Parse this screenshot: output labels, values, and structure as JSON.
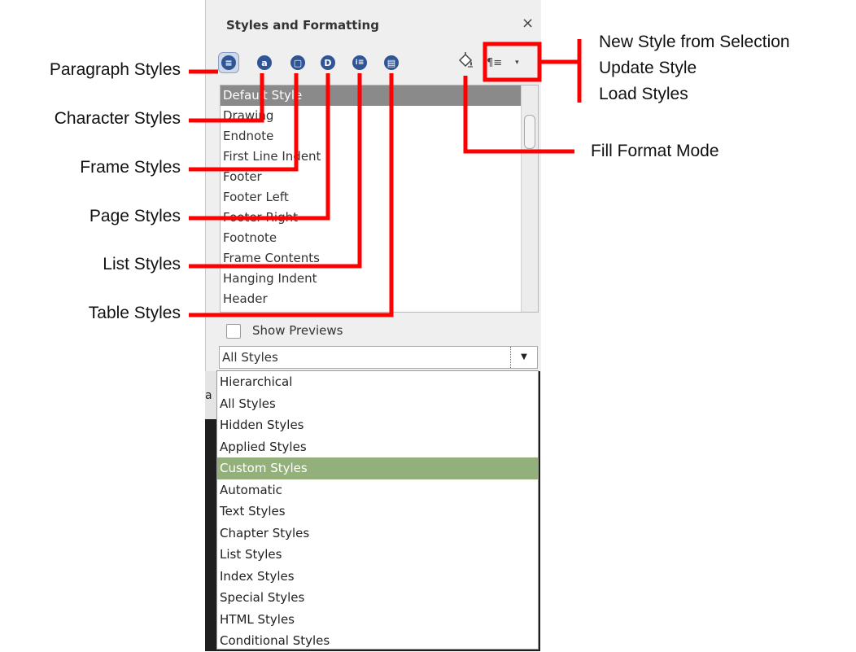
{
  "panel": {
    "title": "Styles and Formatting",
    "close_label": "×",
    "style_categories": [
      "Paragraph Styles",
      "Character Styles",
      "Frame Styles",
      "Page Styles",
      "List Styles",
      "Table Styles"
    ],
    "icon_glyphs": [
      "≡",
      "a",
      "▢",
      "D",
      "⁝≡",
      "▤"
    ],
    "new_style_glyph": "¶≡",
    "new_style_arrow": "▾",
    "styles": [
      "Default Style",
      "Drawing",
      "Endnote",
      "First Line Indent",
      "Footer",
      "Footer Left",
      "Footer Right",
      "Footnote",
      "Frame Contents",
      "Hanging Indent",
      "Header"
    ],
    "selected_style": "Default Style",
    "show_previews_label": "Show Previews",
    "show_previews_checked": false,
    "filter_value": "All Styles",
    "filter_arrow": "▼",
    "filter_options": [
      "Hierarchical",
      "All Styles",
      "Hidden Styles",
      "Applied Styles",
      "Custom Styles",
      "Automatic",
      "Text Styles",
      "Chapter Styles",
      "List Styles",
      "Index Styles",
      "Special Styles",
      "HTML Styles",
      "Conditional Styles"
    ],
    "highlighted_option": "Custom Styles",
    "partial_text": "a"
  },
  "callouts": {
    "left": [
      "Paragraph Styles",
      "Character Styles",
      "Frame Styles",
      "Page Styles",
      "List Styles",
      "Table Styles"
    ],
    "new_style_menu": [
      "New Style from Selection",
      "Update Style",
      "Load Styles"
    ],
    "fill_format": "Fill Format Mode"
  },
  "colors": {
    "accent": "#2f5597",
    "callout": "#ff0000",
    "selected_row": "#8a8a8a",
    "highlighted_option": "#93b07a"
  }
}
